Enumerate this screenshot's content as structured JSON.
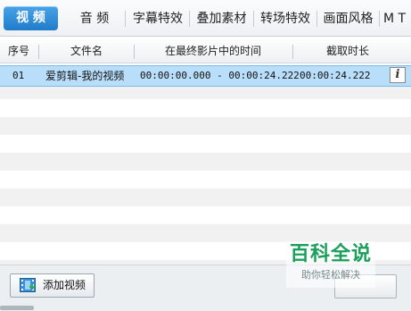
{
  "tabs": [
    {
      "label": "视 频",
      "active": true
    },
    {
      "label": "音 频",
      "active": false
    },
    {
      "label": "字幕特效",
      "active": false
    },
    {
      "label": "叠加素材",
      "active": false
    },
    {
      "label": "转场特效",
      "active": false
    },
    {
      "label": "画面风格",
      "active": false
    },
    {
      "label": "M T",
      "active": false
    }
  ],
  "table": {
    "columns": [
      "序号",
      "文件名",
      "在最终影片中的时间",
      "截取时长"
    ],
    "rows": [
      {
        "index": "01",
        "name": "爱剪辑-我的视频",
        "time": "00:00:00.000 - 00:00:24.222",
        "duration": "00:00:24.222"
      }
    ],
    "info_icon": "i"
  },
  "footer": {
    "add_video_label": "添加视频",
    "add_video_icon": "film-icon"
  },
  "watermark": {
    "title": "百科全说",
    "subtitle": "助你轻松解决"
  },
  "colors": {
    "active_tab": "#2a86d1",
    "selected_row": "#b9def9",
    "watermark_green": "#1aa05a"
  }
}
